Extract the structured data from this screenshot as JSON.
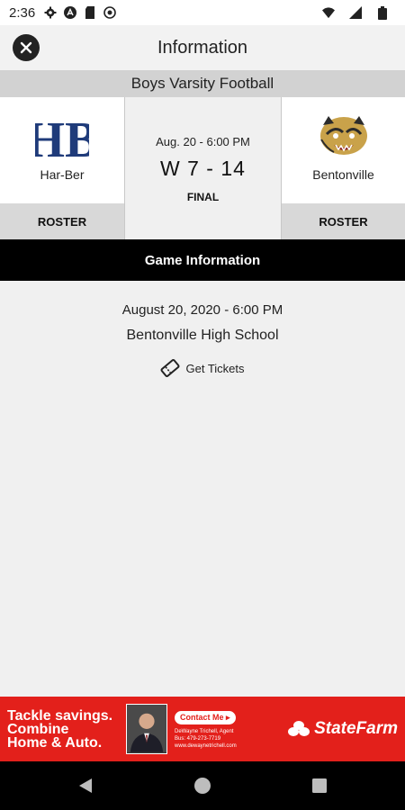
{
  "status_bar": {
    "time": "2:36"
  },
  "header": {
    "title": "Information"
  },
  "sport": "Boys Varsity Football",
  "home_team": {
    "name": "Har-Ber",
    "logo_text": "HB",
    "roster_label": "ROSTER"
  },
  "away_team": {
    "name": "Bentonville",
    "roster_label": "ROSTER"
  },
  "game": {
    "date_time": "Aug. 20 - 6:00 PM",
    "score": "W 7 - 14",
    "status": "FINAL"
  },
  "game_info": {
    "heading": "Game Information",
    "date_time": "August 20, 2020 - 6:00 PM",
    "venue": "Bentonville High School",
    "tickets_label": "Get Tickets"
  },
  "ad": {
    "slogan_lines": [
      "Tackle savings.",
      "Combine",
      "Home & Auto."
    ],
    "contact_label": "Contact Me ▸",
    "agent": "DeWayne Trichell, Agent",
    "phone": "Bus: 479-273-7719",
    "website": "www.dewaynetrichell.com",
    "brand": "StateFarm"
  },
  "colors": {
    "ad_red": "#e3201b",
    "hb_blue": "#1f3b7a",
    "black_bar": "#000000"
  }
}
